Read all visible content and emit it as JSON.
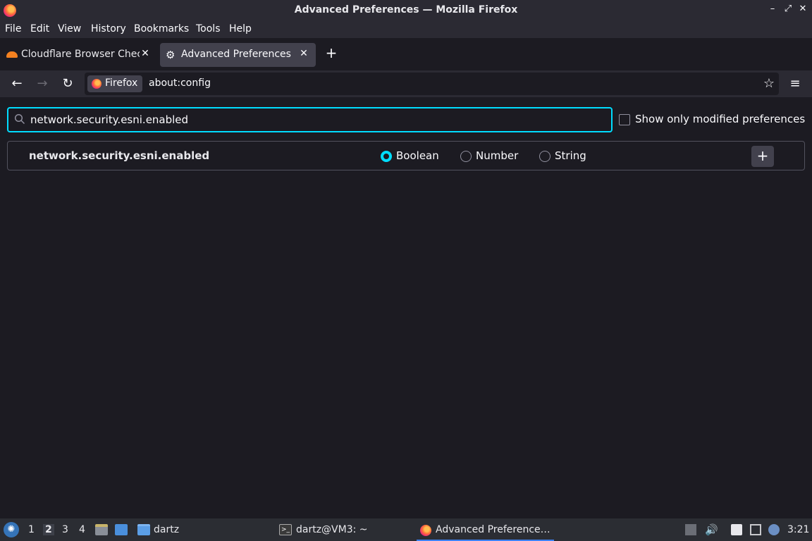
{
  "window": {
    "title": "Advanced Preferences — Mozilla Firefox"
  },
  "menu": [
    "File",
    "Edit",
    "View",
    "History",
    "Bookmarks",
    "Tools",
    "Help"
  ],
  "tabs": [
    {
      "label": "Cloudflare Browser Check",
      "icon": "cloudflare-icon"
    },
    {
      "label": "Advanced Preferences",
      "icon": "gear-icon"
    }
  ],
  "navbar": {
    "identity_label": "Firefox",
    "url": "about:config"
  },
  "search": {
    "value": "network.security.esni.enabled"
  },
  "show_modified_label": "Show only modified preferences",
  "pref": {
    "name": "network.security.esni.enabled",
    "types": [
      {
        "label": "Boolean",
        "selected": true
      },
      {
        "label": "Number",
        "selected": false
      },
      {
        "label": "String",
        "selected": false
      }
    ],
    "add_label": "+"
  },
  "taskbar": {
    "workspaces": [
      "1",
      "2",
      "3",
      "4"
    ],
    "active_workspace": "2",
    "folder_label": "dartz",
    "terminal_label": "dartz@VM3: ~",
    "firefox_task_label": "Advanced Preference…",
    "clock": "3:21"
  },
  "colors": {
    "accent": "#00ddff",
    "background": "#1c1b22",
    "toolbar": "#2b2a33"
  }
}
